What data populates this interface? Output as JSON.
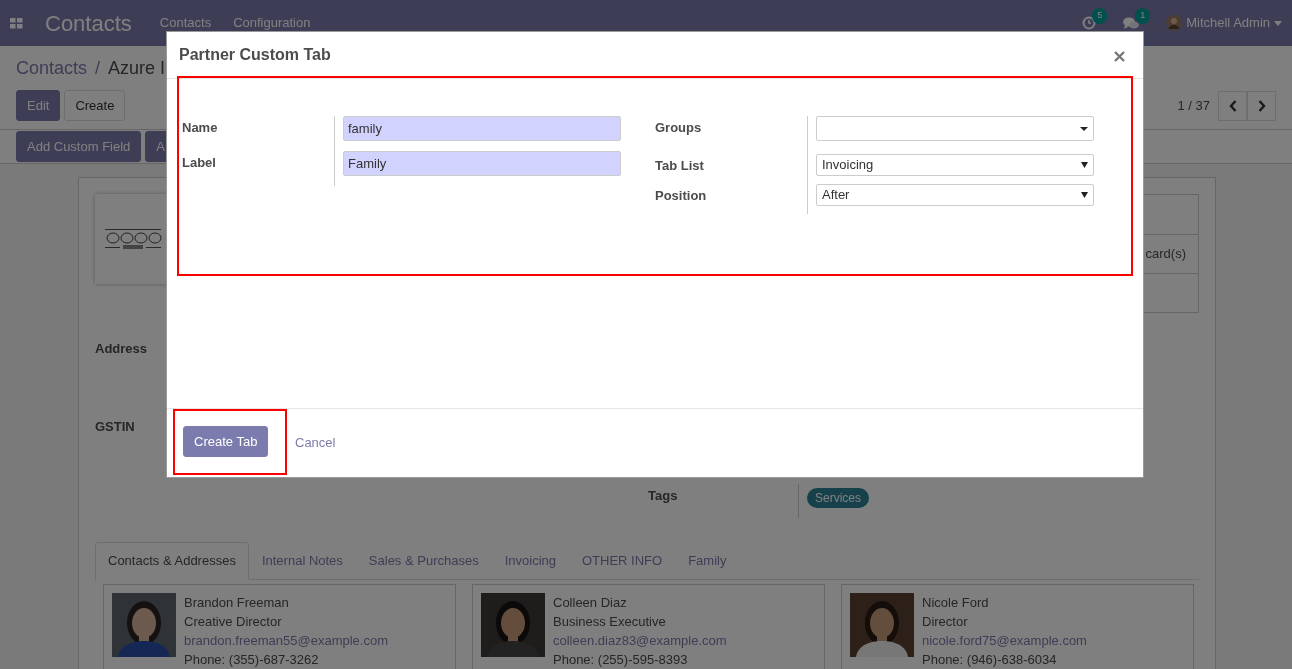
{
  "navbar": {
    "app_title": "Contacts",
    "menu": [
      "Contacts",
      "Configuration"
    ],
    "activity_count": "5",
    "message_count": "1",
    "user": "Mitchell Admin"
  },
  "breadcrumb": {
    "items": [
      "Contacts",
      "Azure I"
    ],
    "separator": "/"
  },
  "control_buttons": [
    {
      "label": "Edit",
      "kind": "primary"
    },
    {
      "label": "Create",
      "kind": "secondary"
    }
  ],
  "pager": "1 / 37",
  "action_buttons": [
    "Add Custom Field",
    "A"
  ],
  "stat_buttons": [
    {
      "kind": "empty"
    },
    {
      "kind": "text",
      "label": "card(s)"
    },
    {
      "kind": "empty"
    }
  ],
  "fields": [
    {
      "label": "Address"
    },
    {
      "label": "GSTIN"
    }
  ],
  "tags_field": {
    "label": "Tags",
    "tags": [
      {
        "text": "Services"
      }
    ]
  },
  "tabs": [
    {
      "label": "Contacts & Addresses",
      "selected": true
    },
    {
      "label": "Internal Notes",
      "selected": false
    },
    {
      "label": "Sales & Purchases",
      "selected": false
    },
    {
      "label": "Invoicing",
      "selected": false
    },
    {
      "label": "OTHER INFO",
      "selected": false
    },
    {
      "label": "Family",
      "selected": false
    }
  ],
  "contacts": [
    {
      "name": "Brandon Freeman",
      "title": "Creative Director",
      "email": "brandon.freeman55@example.com",
      "phone": "Phone: (355)-687-3262"
    },
    {
      "name": "Colleen Diaz",
      "title": "Business Executive",
      "email": "colleen.diaz83@example.com",
      "phone": "Phone: (255)-595-8393"
    },
    {
      "name": "Nicole Ford",
      "title": "Director",
      "email": "nicole.ford75@example.com",
      "phone": "Phone: (946)-638-6034"
    }
  ],
  "dialog": {
    "title": "Partner Custom Tab",
    "left_fields": [
      {
        "label": "Name",
        "kind": "text",
        "value": "family"
      },
      {
        "label": "Label",
        "kind": "text",
        "value": "Family"
      }
    ],
    "right_fields": [
      {
        "label": "Groups",
        "kind": "many2one"
      },
      {
        "label": "Tab List",
        "kind": "selection",
        "value": "Invoicing"
      },
      {
        "label": "Position",
        "kind": "selection",
        "value": "After"
      }
    ],
    "buttons": [
      {
        "label": "Create Tab",
        "kind": "primary"
      },
      {
        "label": "Cancel",
        "kind": "link"
      }
    ]
  }
}
